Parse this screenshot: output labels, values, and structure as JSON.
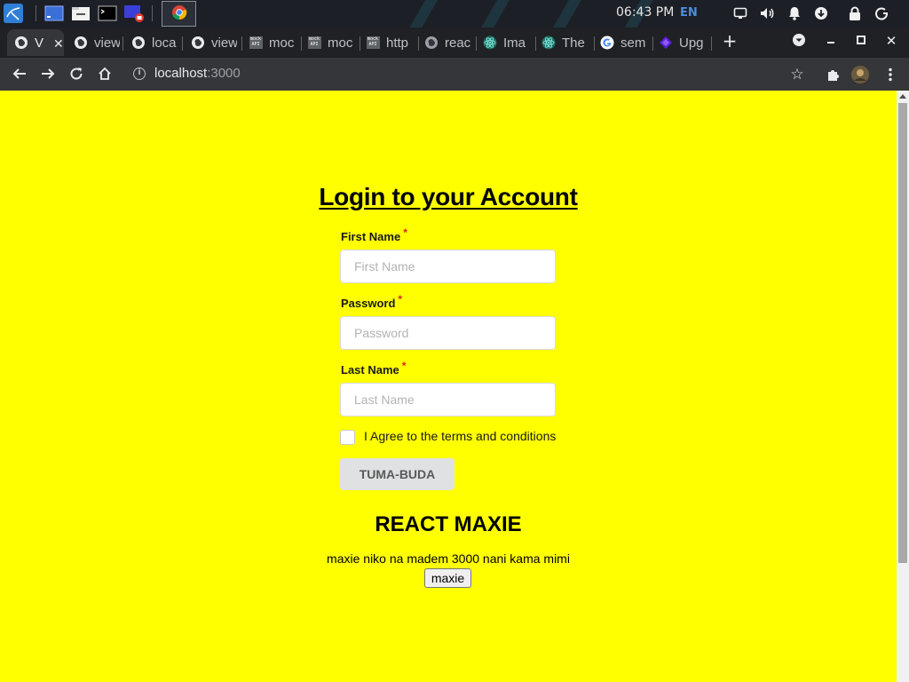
{
  "taskbar": {
    "clock": "06:43 PM",
    "language": "EN",
    "launchers": [
      "kali-menu-icon",
      "workspace-icon",
      "file-manager-icon",
      "terminal-icon",
      "screen-recorder-icon"
    ],
    "active_app": "chrome-icon"
  },
  "browser": {
    "tabs": [
      {
        "title": "V",
        "favicon": "globe-icon",
        "active": true
      },
      {
        "title": "view",
        "favicon": "globe-icon"
      },
      {
        "title": "loca",
        "favicon": "globe-icon"
      },
      {
        "title": "view",
        "favicon": "globe-icon"
      },
      {
        "title": "moc",
        "favicon": "mock-api-icon"
      },
      {
        "title": "moc",
        "favicon": "mock-api-icon"
      },
      {
        "title": "http",
        "favicon": "mock-api-icon"
      },
      {
        "title": "reac",
        "favicon": "globe-icon"
      },
      {
        "title": "Ima",
        "favicon": "react-icon"
      },
      {
        "title": "The",
        "favicon": "react-icon"
      },
      {
        "title": "sem",
        "favicon": "google-icon"
      },
      {
        "title": "Upg",
        "favicon": "diamond-icon"
      }
    ],
    "url_host": "localhost",
    "url_port": ":3000"
  },
  "form": {
    "heading": "Login to your Account",
    "fields": [
      {
        "label": "First Name",
        "placeholder": "First Name",
        "required_mark": "*"
      },
      {
        "label": "Password",
        "placeholder": "Password",
        "required_mark": "*"
      },
      {
        "label": "Last Name",
        "placeholder": "Last Name",
        "required_mark": "*"
      }
    ],
    "terms_label": "I Agree to the terms and conditions",
    "submit_label": "TUMA-BUDA"
  },
  "footer": {
    "title": "REACT MAXIE",
    "text": "maxie niko na madem 3000 nani kama mimi",
    "button_label": "maxie"
  },
  "colors": {
    "page_background": "#ffff00",
    "required_mark": "#e02020",
    "browser_chrome": "#35363a",
    "tab_strip": "#202124"
  }
}
